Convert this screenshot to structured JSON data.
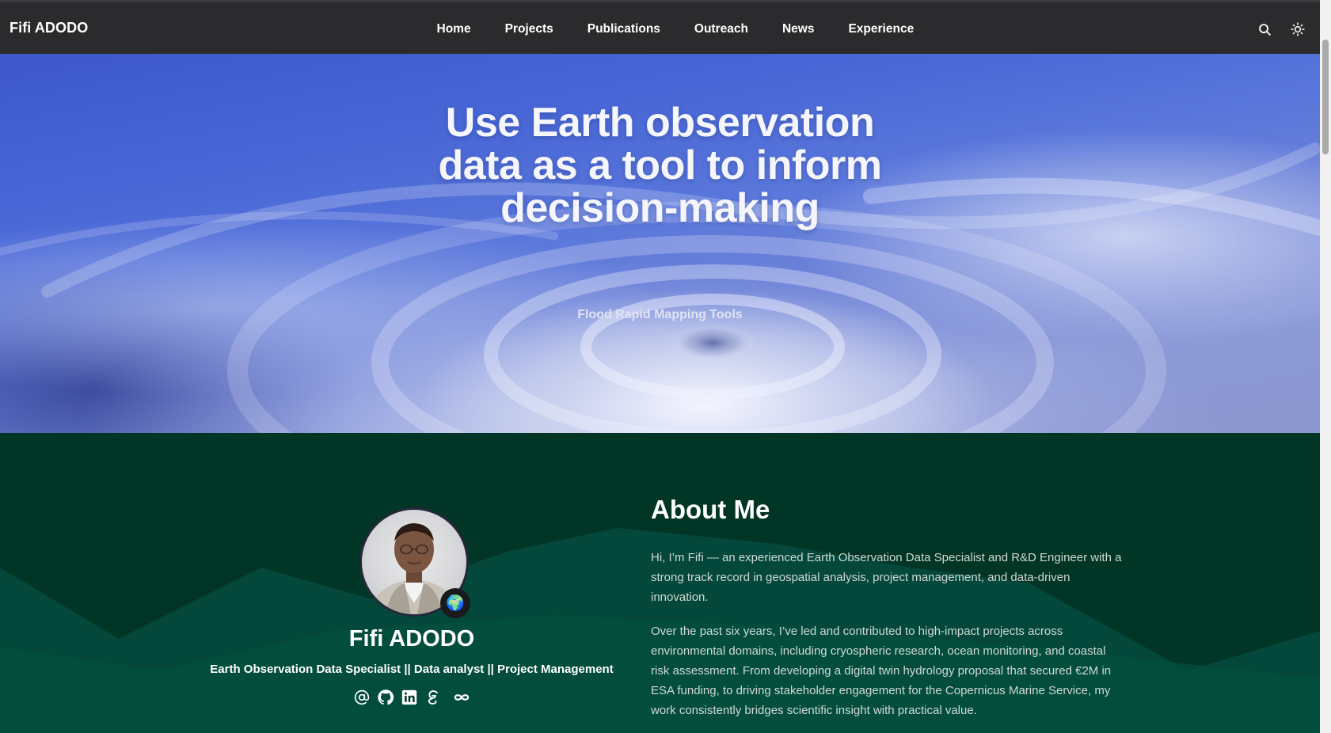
{
  "site": {
    "brand": "Fifi ADODO"
  },
  "nav": {
    "items": [
      {
        "label": "Home"
      },
      {
        "label": "Projects"
      },
      {
        "label": "Publications"
      },
      {
        "label": "Outreach"
      },
      {
        "label": "News"
      },
      {
        "label": "Experience"
      }
    ],
    "tools": [
      "search-icon",
      "sun-icon"
    ]
  },
  "hero": {
    "title_lines": [
      "Use Earth observation",
      "data as a tool to inform",
      "decision-making"
    ],
    "subtitle": "Flood Rapid Mapping Tools"
  },
  "profile": {
    "name": "Fifi ADODO",
    "role": "Earth Observation Data Specialist || Data analyst || Project Management",
    "badge_emoji": "🌍",
    "social_icons": [
      "at-icon",
      "github-icon",
      "linkedin-icon",
      "google-scholar-icon",
      "infinity-icon"
    ]
  },
  "about": {
    "title": "About Me",
    "paragraphs": [
      "Hi, I’m Fifi — an experienced Earth Observation Data Specialist and R&D Engineer with a strong track record in geospatial analysis, project management, and data-driven innovation.",
      "Over the past six years, I’ve led and contributed to high-impact projects across environmental domains, including cryospheric research, ocean monitoring, and coastal risk assessment. From developing a digital twin hydrology proposal that secured €2M in ESA funding, to driving stakeholder engagement for the Copernicus Marine Service, my work consistently bridges scientific insight with practical value."
    ]
  },
  "colors": {
    "navbar": "#2b2b2d",
    "about_bg": "#013526",
    "about_band": "#03483a",
    "hero_blue": "#4866d6"
  }
}
